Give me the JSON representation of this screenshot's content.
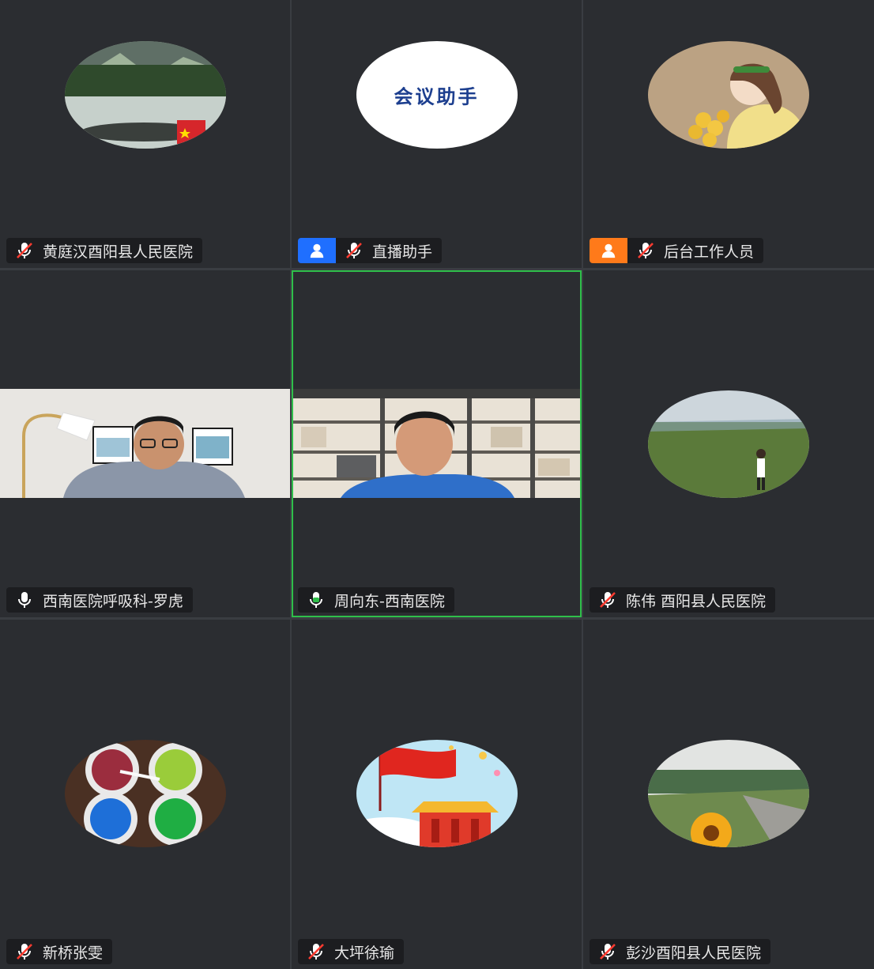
{
  "participants": [
    {
      "name": "黄庭汉酉阳县人民医院",
      "mic": "muted-mic-icon",
      "avatar": "landscape-pond-avatar"
    },
    {
      "name": "直播助手",
      "mic": "muted-mic-icon",
      "avatar": "meeting-assistant-avatar",
      "avatar_text": "会议助手",
      "role_badge": "user-icon-blue"
    },
    {
      "name": "后台工作人员",
      "mic": "muted-mic-icon",
      "avatar": "girl-flowers-avatar",
      "role_badge": "user-icon-orange"
    },
    {
      "name": "西南医院呼吸科-罗虎",
      "mic": "mic-icon",
      "video": "man-in-living-room-video"
    },
    {
      "name": "周向东-西南医院",
      "mic": "speaking-mic-icon",
      "video": "man-in-office-video",
      "active_speaker": true
    },
    {
      "name": "陈伟 酉阳县人民医院",
      "mic": "muted-mic-icon",
      "avatar": "grassland-avatar"
    },
    {
      "name": "新桥张雯",
      "mic": "muted-mic-icon",
      "avatar": "colored-bowls-avatar"
    },
    {
      "name": "大坪徐瑜",
      "mic": "muted-mic-icon",
      "avatar": "flag-gate-avatar"
    },
    {
      "name": "彭沙酉阳县人民医院",
      "mic": "muted-mic-icon",
      "avatar": "flower-road-avatar"
    }
  ],
  "colors": {
    "tile_bg": "#2b2d31",
    "active_border": "#2fbf4a",
    "badge_blue": "#1f6fff",
    "badge_orange": "#ff7a1a",
    "muted_slash": "#ff3b30"
  }
}
